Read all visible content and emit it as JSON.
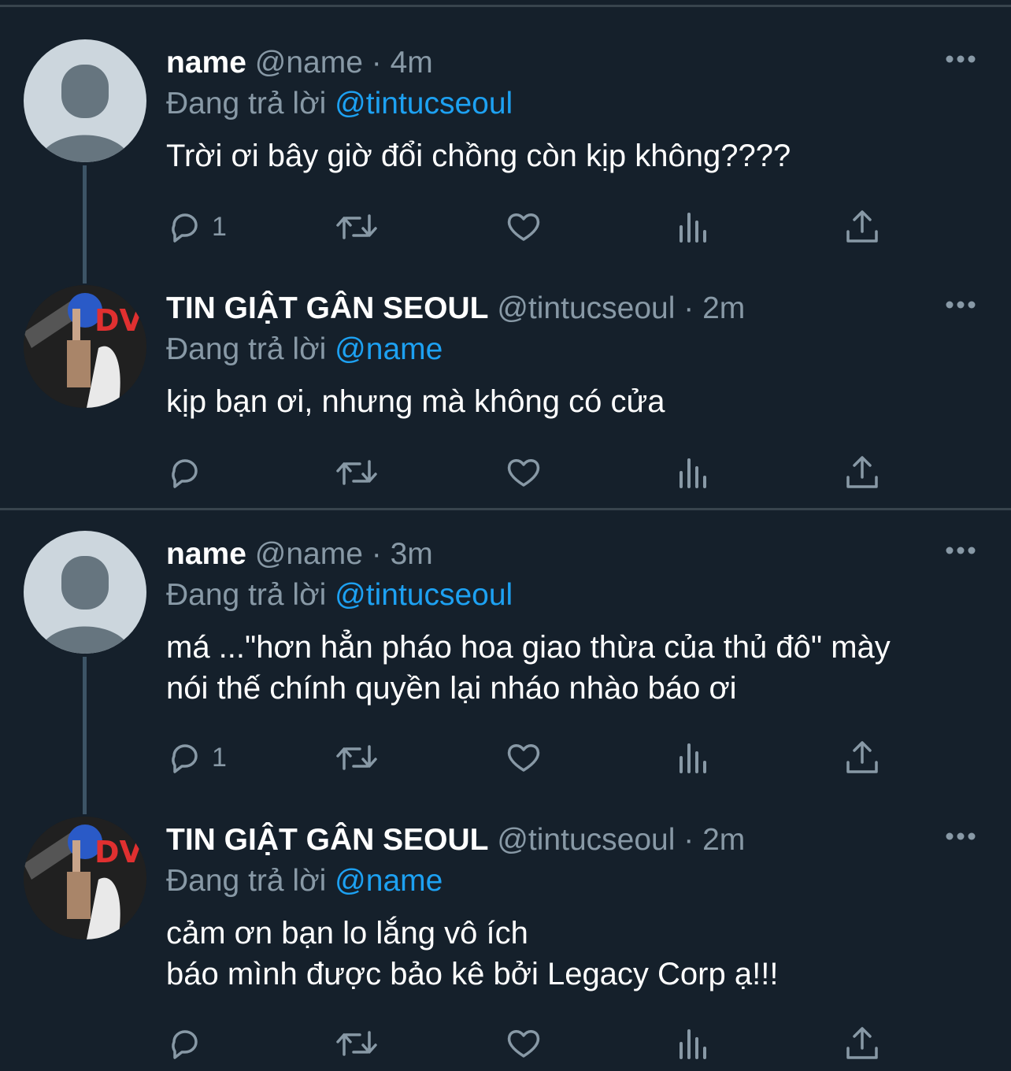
{
  "tweets": [
    {
      "name": "name",
      "handle": "@name",
      "separator": "·",
      "time": "4m",
      "replying_prefix": "Đang trả lời",
      "replying_to": "@tintucseoul",
      "text": "Trời ơi bây giờ đổi chồng còn kịp không????",
      "reply_count": "1",
      "avatar": "default-avatar"
    },
    {
      "name": "TIN GIẬT GÂN SEOUL",
      "handle": "@tintucseoul",
      "separator": "·",
      "time": "2m",
      "replying_prefix": "Đang trả lời",
      "replying_to": "@name",
      "text": "kịp bạn ơi, nhưng mà không có cửa",
      "reply_count": "",
      "avatar": "photo-avatar"
    },
    {
      "name": "name",
      "handle": "@name",
      "separator": "·",
      "time": "3m",
      "replying_prefix": "Đang trả lời",
      "replying_to": "@tintucseoul",
      "text": "má ...\"hơn hẳn pháo hoa giao thừa của thủ đô\" mày\nnói thế chính quyền lại nháo nhào báo ơi",
      "reply_count": "1",
      "avatar": "default-avatar"
    },
    {
      "name": "TIN GIẬT GÂN SEOUL",
      "handle": "@tintucseoul",
      "separator": "·",
      "time": "2m",
      "replying_prefix": "Đang trả lời",
      "replying_to": "@name",
      "text": "cảm ơn bạn lo lắng vô ích\nbáo mình được bảo kê bởi Legacy Corp ạ!!!",
      "reply_count": "",
      "avatar": "photo-avatar"
    }
  ],
  "avatar_text": "DV",
  "colors": {
    "background": "#15202b",
    "text": "#ffffff",
    "muted": "#8899a6",
    "mention": "#1da1f2",
    "divider": "#38444d"
  },
  "icons": [
    "more-icon",
    "reply-icon",
    "retweet-icon",
    "like-icon",
    "analytics-icon",
    "share-icon"
  ]
}
